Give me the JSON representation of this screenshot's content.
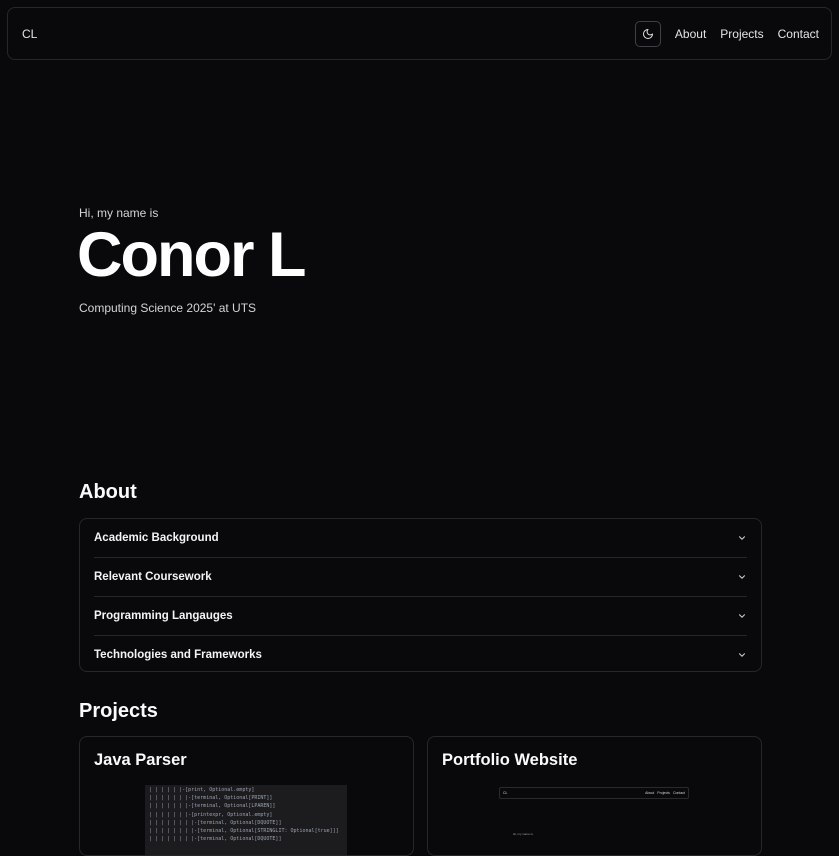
{
  "nav": {
    "brand": "CL",
    "theme_icon": "moon-icon",
    "links": [
      "About",
      "Projects",
      "Contact"
    ]
  },
  "hero": {
    "intro": "Hi, my name is",
    "name": "Conor L",
    "subtitle": "Computing Science 2025' at UTS"
  },
  "about": {
    "title": "About",
    "items": [
      "Academic Background",
      "Relevant Coursework",
      "Programming Langauges",
      "Technologies and Frameworks"
    ]
  },
  "projects": {
    "title": "Projects",
    "cards": [
      {
        "title": "Java Parser",
        "preview_lines": [
          "| | | | | |-[print, Optional.empty]",
          "| | | | | | |-[terminal, Optional[PRINT]]",
          "| | | | | | |-[terminal, Optional[LPAREN]]",
          "| | | | | | |-[printexpr, Optional.empty]",
          "| | | | | | | |-[terminal, Optional[DQUOTE]]",
          "| | | | | | | |-[terminal, Optional[STRINGLIT: Optional[true]]]",
          "| | | | | | | |-[terminal, Optional[DQUOTE]]"
        ]
      },
      {
        "title": "Portfolio Website",
        "preview": {
          "brand": "CL",
          "links": [
            "About",
            "Projects",
            "Contact"
          ],
          "intro": "Hi, my name is"
        }
      }
    ]
  },
  "colors": {
    "background": "#09090b",
    "border": "#27272a",
    "text": "#fafafa"
  }
}
